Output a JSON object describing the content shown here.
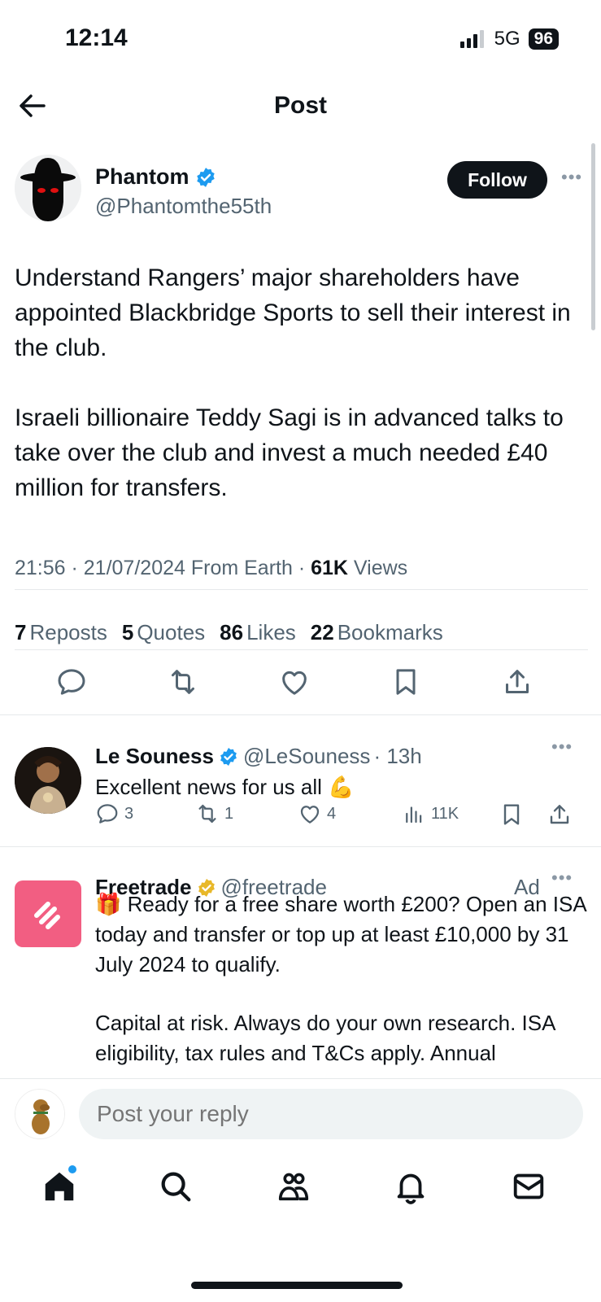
{
  "status_bar": {
    "time": "12:14",
    "network": "5G",
    "battery": "96"
  },
  "header": {
    "title": "Post"
  },
  "post": {
    "author_name": "Phantom",
    "author_handle": "@Phantomthe55th",
    "follow_label": "Follow",
    "paragraph_1": "Understand Rangers’ major shareholders have appointed Blackbridge Sports to sell their interest in the club.",
    "paragraph_2": "Israeli billionaire Teddy Sagi is in advanced talks to take over the club and invest a much needed £40 million for transfers.",
    "timestamp": "21:56 · 21/07/2024 From Earth · ",
    "views_count": "61K",
    "views_label": " Views",
    "stats": {
      "reposts": "7",
      "reposts_label": "Reposts",
      "quotes": "5",
      "quotes_label": "Quotes",
      "likes": "86",
      "likes_label": "Likes",
      "bookmarks": "22",
      "bookmarks_label": "Bookmarks"
    }
  },
  "reply": {
    "author_name": "Le Souness",
    "author_handle": "@LeSouness",
    "time": "· 13h",
    "text": "Excellent news for us all 💪",
    "replies": "3",
    "reposts": "1",
    "likes": "4",
    "views": "11K"
  },
  "ad": {
    "author_name": "Freetrade",
    "author_handle": "@freetrade",
    "ad_label": "Ad",
    "line_1": "🎁 Ready for a free share worth £200? Open an ISA today and transfer or top up at least £10,000 by 31 July 2024 to qualify.",
    "line_2": "Capital at risk. Always do your own research. ISA eligibility, tax rules and T&Cs apply. Annual"
  },
  "reply_bar": {
    "placeholder": "Post your reply"
  },
  "colors": {
    "accent": "#1d9bf0",
    "verified_gold": "#e8b829",
    "freetrade_pink": "#f25e82"
  }
}
